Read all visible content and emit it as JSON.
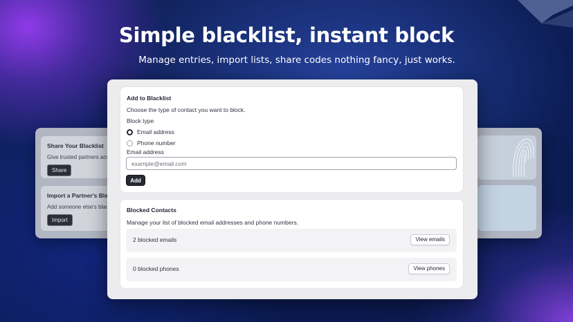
{
  "hero": {
    "title": "Simple blacklist, instant block",
    "subtitle": "Manage entries, import lists, share codes  nothing fancy, just works."
  },
  "background_panel": {
    "share": {
      "title": "Share Your Blacklist",
      "text": "Give trusted partners acc",
      "button": "Share"
    },
    "import": {
      "title": "Import a Partner's Blackl",
      "text": "Add someone else's blac",
      "button": "Import"
    }
  },
  "add_card": {
    "title": "Add to Blacklist",
    "description": "Choose the type of contact you want to block.",
    "block_type_label": "Block type",
    "options": [
      {
        "label": "Email address",
        "checked": true
      },
      {
        "label": "Phone number",
        "checked": false
      }
    ],
    "email_label": "Email address",
    "email_placeholder": "example@email.com",
    "email_value": "",
    "add_button": "Add"
  },
  "blocked_card": {
    "title": "Blocked Contacts",
    "description": "Manage your list of blocked email addresses and phone numbers.",
    "rows": [
      {
        "label": "2 blocked emails",
        "button": "View emails"
      },
      {
        "label": "0 blocked phones",
        "button": "View phones"
      }
    ]
  },
  "colors": {
    "primary_button": "#262a33",
    "background_dark": "#0b1a4a",
    "accent_purple": "#9640f0"
  }
}
